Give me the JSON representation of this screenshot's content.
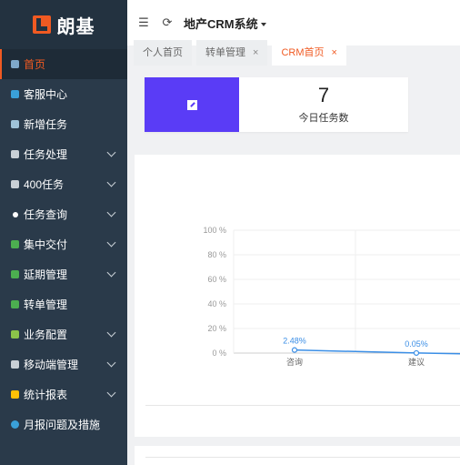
{
  "logo": {
    "text": "朗基"
  },
  "sidebar": {
    "items": [
      {
        "label": "首页",
        "icon": "home-icon",
        "icon_color": "#7fa8c9",
        "has_children": false,
        "active": true
      },
      {
        "label": "客服中心",
        "icon": "customer-service-icon",
        "icon_color": "#3aa0d8",
        "has_children": false
      },
      {
        "label": "新增任务",
        "icon": "cloud-icon",
        "icon_color": "#9fc3d9",
        "has_children": false
      },
      {
        "label": "任务处理",
        "icon": "gear-icon",
        "icon_color": "#c9d0d6",
        "has_children": true
      },
      {
        "label": "400任务",
        "icon": "gear-icon",
        "icon_color": "#c9d0d6",
        "has_children": true
      },
      {
        "label": "任务查询",
        "icon": "dot-icon",
        "icon_color": "#ffffff",
        "has_children": true
      },
      {
        "label": "集中交付",
        "icon": "stack-icon",
        "icon_color": "#4caf50",
        "has_children": true
      },
      {
        "label": "延期管理",
        "icon": "stack-icon",
        "icon_color": "#4caf50",
        "has_children": true
      },
      {
        "label": "转单管理",
        "icon": "stack-icon",
        "icon_color": "#4caf50",
        "has_children": false
      },
      {
        "label": "业务配置",
        "icon": "leaf-icon",
        "icon_color": "#8bc34a",
        "has_children": true
      },
      {
        "label": "移动端管理",
        "icon": "mobile-icon",
        "icon_color": "#c9d0d6",
        "has_children": true
      },
      {
        "label": "统计报表",
        "icon": "bar-chart-icon",
        "icon_color": "#ffc107",
        "has_children": true
      },
      {
        "label": "月报问题及措施",
        "icon": "info-icon",
        "icon_color": "#3aa0d8",
        "has_children": false
      }
    ]
  },
  "topbar": {
    "title": "地产CRM系统"
  },
  "tabs": [
    {
      "label": "个人首页",
      "closable": false,
      "active": false
    },
    {
      "label": "转单管理",
      "closable": true,
      "active": false
    },
    {
      "label": "CRM首页",
      "closable": true,
      "active": true
    }
  ],
  "close_glyph": "×",
  "stat": {
    "value": "7",
    "label": "今日任务数",
    "color": "#5a3cf6"
  },
  "chart_data": {
    "type": "line",
    "categories": [
      "咨询",
      "建议"
    ],
    "series": [
      {
        "values": [
          2.48,
          0.05
        ],
        "labels": [
          "2.48%",
          "0.05%"
        ],
        "color": "#3a8ee6"
      }
    ],
    "y_ticks": [
      "100 %",
      "80 %",
      "60 %",
      "40 %",
      "20 %",
      "0 %"
    ],
    "ylim": [
      0,
      100
    ],
    "grid": true
  }
}
